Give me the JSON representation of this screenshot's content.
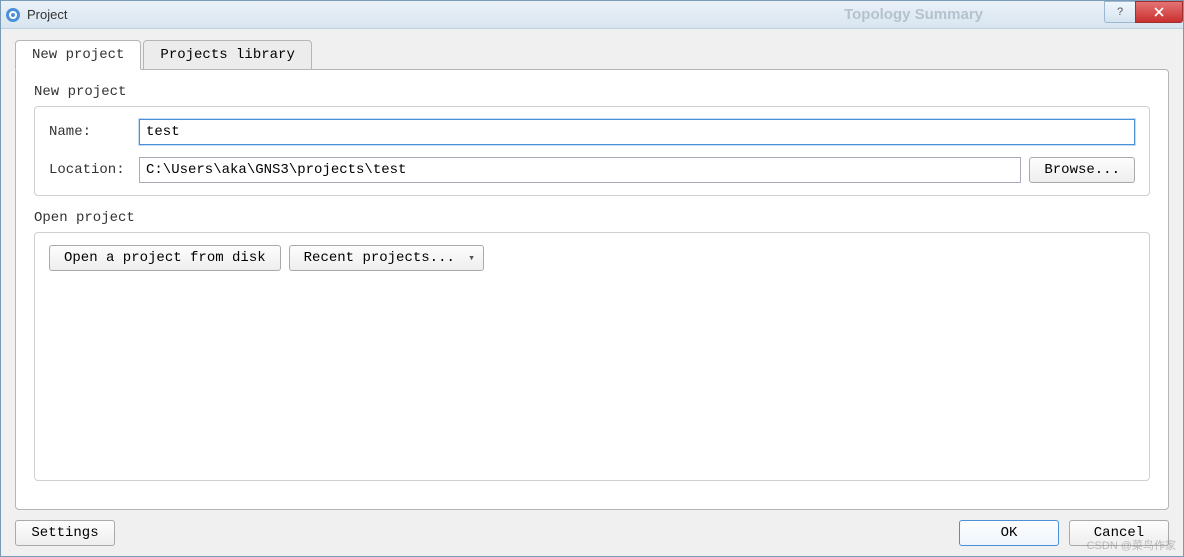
{
  "window": {
    "title": "Project",
    "ghost_label": "Topology Summary"
  },
  "tabs": {
    "new_project": "New project",
    "projects_library": "Projects library"
  },
  "new_project_group": {
    "legend": "New project",
    "name_label": "Name:",
    "name_value": "test",
    "location_label": "Location:",
    "location_value": "C:\\Users\\aka\\GNS3\\projects\\test",
    "browse_label": "Browse..."
  },
  "open_project_group": {
    "legend": "Open project",
    "open_from_disk": "Open a project from disk",
    "recent_projects": "Recent projects..."
  },
  "footer": {
    "settings": "Settings",
    "ok": "OK",
    "cancel": "Cancel"
  },
  "watermark": "CSDN @菜鸟作家"
}
